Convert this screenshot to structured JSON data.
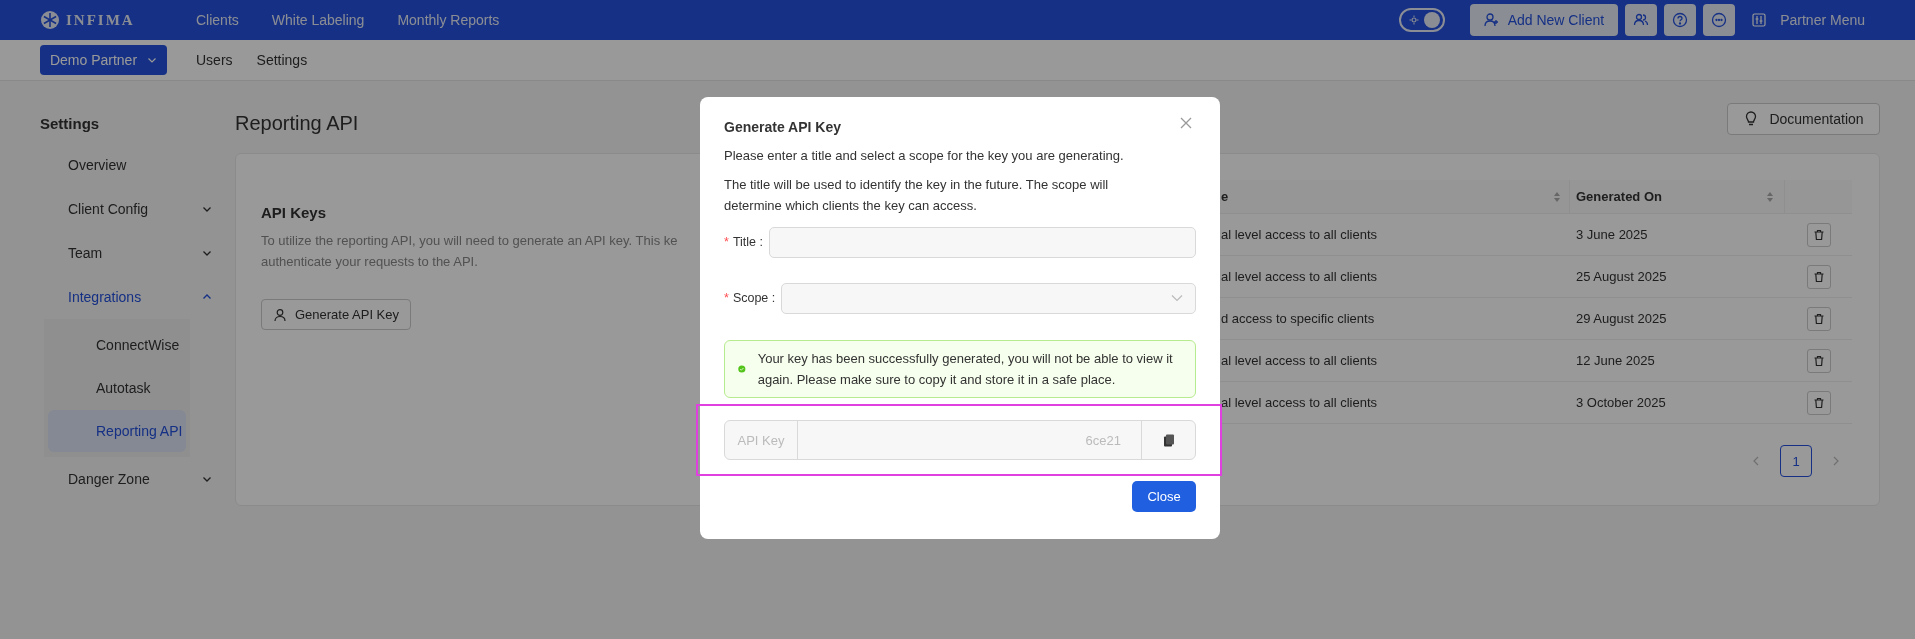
{
  "top_bar": {
    "logo": "INFIMA",
    "nav": [
      {
        "label": "Clients"
      },
      {
        "label": "White Labeling"
      },
      {
        "label": "Monthly Reports"
      }
    ],
    "theme_toggle": {
      "on": true
    },
    "add_client_button": "Add New Client",
    "partner_menu": "Partner Menu"
  },
  "sub_bar": {
    "partner_dropdown": "Demo Partner",
    "links": [
      {
        "label": "Users"
      },
      {
        "label": "Settings"
      }
    ]
  },
  "sidebar": {
    "title": "Settings",
    "items": [
      {
        "label": "Overview",
        "kind": "link",
        "active": false
      },
      {
        "label": "Client Config",
        "kind": "group",
        "active": false,
        "expanded": false
      },
      {
        "label": "Team",
        "kind": "group",
        "active": false,
        "expanded": false
      },
      {
        "label": "Integrations",
        "kind": "group",
        "active": true,
        "expanded": true,
        "children": [
          {
            "label": "ConnectWise",
            "selected": false
          },
          {
            "label": "Autotask",
            "selected": false
          },
          {
            "label": "Reporting API",
            "selected": true
          }
        ]
      },
      {
        "label": "Danger Zone",
        "kind": "group",
        "active": false,
        "expanded": false
      }
    ]
  },
  "main": {
    "title": "Reporting API",
    "documentation_button": "Documentation",
    "api_keys": {
      "title": "API Keys",
      "description_lines": [
        "To utilize the reporting API, you will need to generate an API key. This ke",
        "authenticate your requests to the API."
      ],
      "generate_button": "Generate API Key"
    },
    "table": {
      "columns": [
        {
          "label": "e"
        },
        {
          "label": "Generated On"
        }
      ],
      "rows": [
        {
          "cells": [
            "al level access to all clients",
            "3 June 2025"
          ]
        },
        {
          "cells": [
            "al level access to all clients",
            "25 August 2025"
          ]
        },
        {
          "cells": [
            "d access to specific clients",
            "29 August 2025"
          ]
        },
        {
          "cells": [
            "al level access to all clients",
            "12 June 2025"
          ]
        },
        {
          "cells": [
            "al level access to all clients",
            "3 October 2025"
          ]
        }
      ]
    },
    "pagination": {
      "pages": [
        {
          "label": "1",
          "selected": true
        }
      ]
    }
  },
  "modal": {
    "title": "Generate API Key",
    "intro": "Please enter a title and select a scope for the key you are generating.",
    "explanation": "The title will be used to identify the key in the future. The scope will determine which clients the key can access.",
    "fields": [
      {
        "label": "Title :",
        "required_mark": "*",
        "kind": "text"
      },
      {
        "label": "Scope :",
        "required_mark": "*",
        "kind": "select"
      }
    ],
    "alert": {
      "kind": "success",
      "message": "Your key has been successfully generated, you will not be able to view it again. Please make sure to copy it and store it in a safe place."
    },
    "api_key": {
      "addon": "API Key",
      "value": "6ce21",
      "disabled": true,
      "highlighted": true
    },
    "close_button": "Close"
  }
}
